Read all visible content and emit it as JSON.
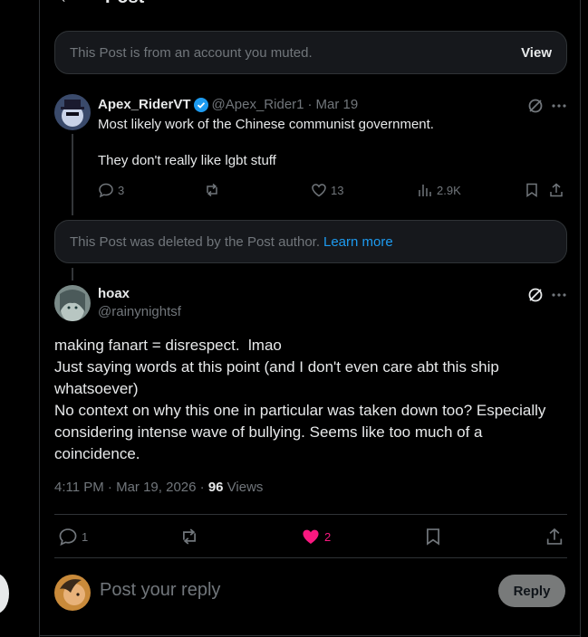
{
  "header": {
    "title": "Post",
    "back_icon": "arrow-left-icon"
  },
  "muted_notice": {
    "text": "This Post is from an account you muted.",
    "view_label": "View"
  },
  "parent_post": {
    "display_name": "Apex_RiderVT",
    "handle": "@Apex_Rider1",
    "separator": "·",
    "date": "Mar 19",
    "lines": [
      "Most likely work of the Chinese communist government.",
      "They don't really like lgbt stuff"
    ],
    "replies": "3",
    "reposts": "",
    "likes": "13",
    "views": "2.9K"
  },
  "deleted_notice": {
    "text": "This Post was deleted by the Post author.",
    "learn_more": "Learn more"
  },
  "main_post": {
    "display_name": "hoax",
    "handle": "@rainynightsf",
    "lines": [
      "making fanart = disrespect.  lmao",
      "Just saying words at this point (and I don't even care abt this ship whatsoever)",
      "No context on why this one in particular was taken down too? Especially considering intense wave of bullying. Seems like too much of a coincidence."
    ],
    "time": "4:11 PM · Mar 19, 2026 · ",
    "views_count": "96",
    "views_label": "Views",
    "replies": "1",
    "likes": "2"
  },
  "reply_box": {
    "placeholder": "Post your reply",
    "button": "Reply"
  },
  "colors": {
    "like_active": "#f91880",
    "link": "#1d9bf0",
    "verified": "#1d9bf0"
  }
}
